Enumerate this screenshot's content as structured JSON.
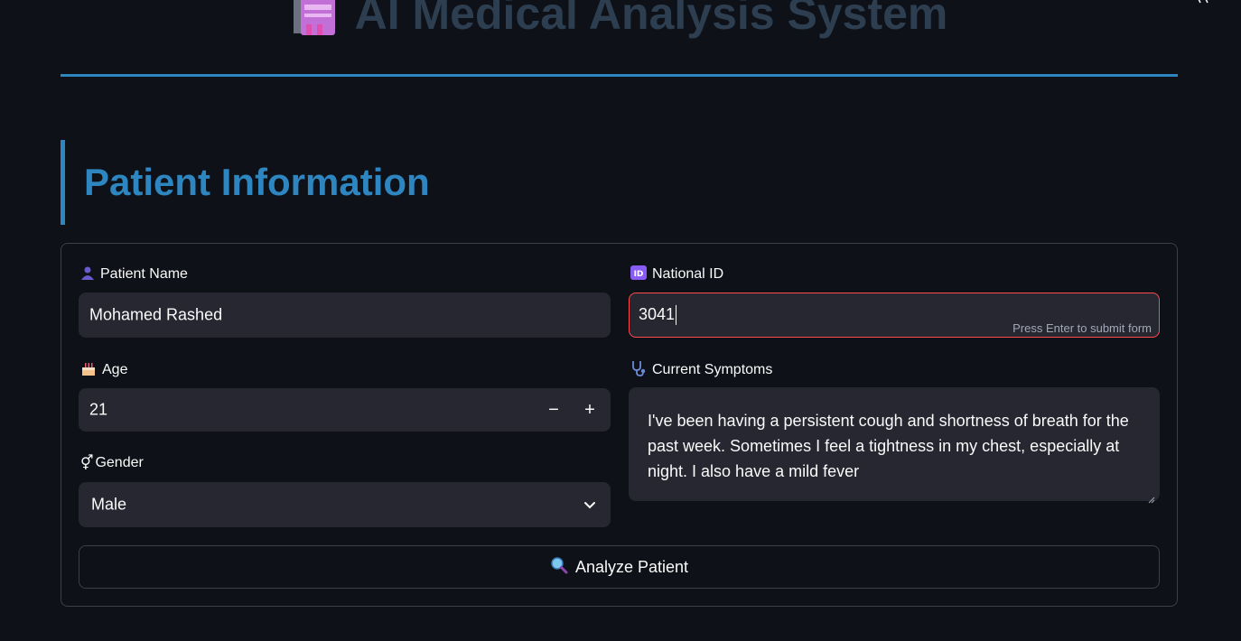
{
  "header": {
    "title": "AI Medical Analysis System",
    "logo_icon": "medical-clipboard-icon"
  },
  "section": {
    "title": "Patient Information"
  },
  "form": {
    "patient_name": {
      "label": "Patient Name",
      "icon": "person-icon",
      "value": "Mohamed Rashed"
    },
    "national_id": {
      "label": "National ID",
      "icon": "id-icon",
      "value": "3041",
      "hint": "Press Enter to submit form"
    },
    "age": {
      "label": "Age",
      "icon": "cake-icon",
      "value": "21",
      "decrement": "−",
      "increment": "+"
    },
    "gender": {
      "label": "Gender",
      "icon": "gender-icon",
      "value": "Male"
    },
    "symptoms": {
      "label": "Current Symptoms",
      "icon": "stethoscope-icon",
      "value": "I've been having a persistent cough and shortness of breath for the past week. Sometimes I feel a tightness in my chest, especially at night. I also have a mild fever"
    },
    "submit": {
      "label": "Analyze Patient",
      "icon": "magnifier-icon"
    }
  },
  "colors": {
    "background": "#0e1117",
    "accent": "#2e86c1",
    "input_bg": "#262730",
    "focus_border": "#ff4b4b",
    "title_muted": "#2c3e50"
  }
}
